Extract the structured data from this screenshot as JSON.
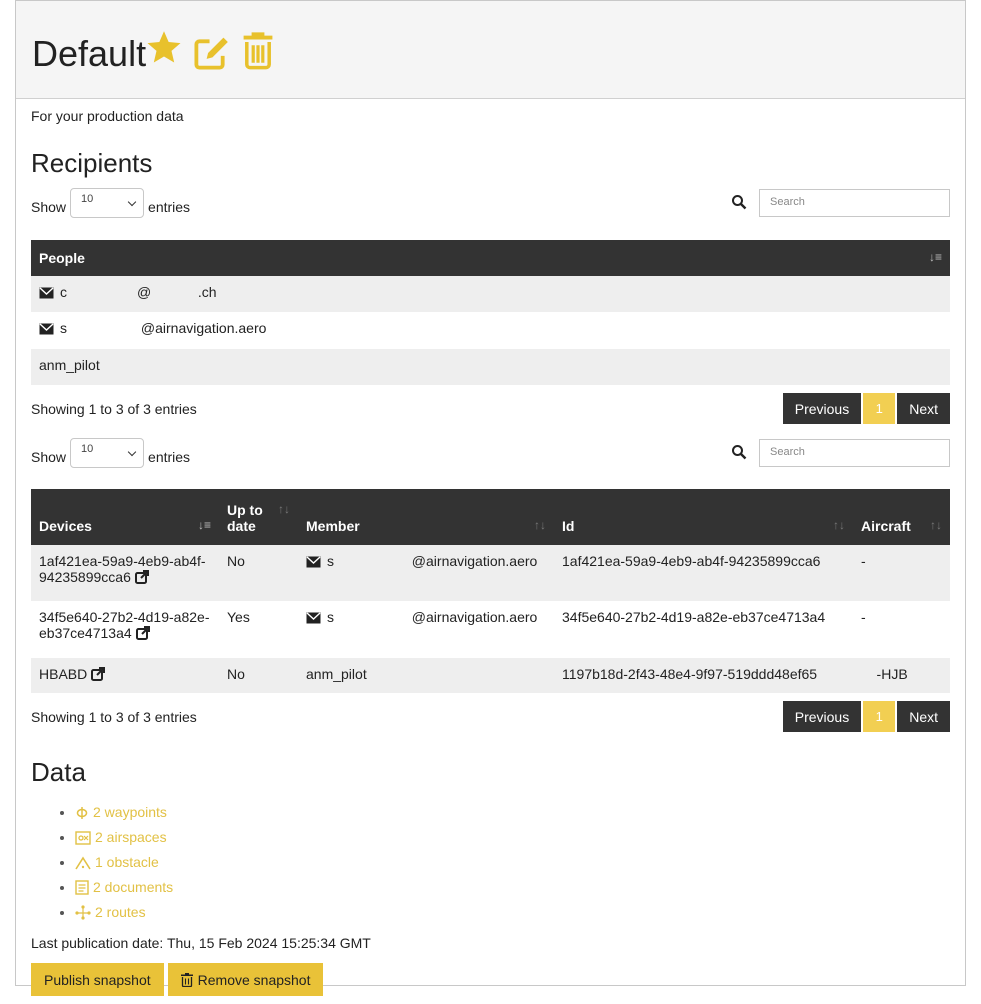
{
  "header": {
    "title": "Default",
    "icons": [
      "star-icon",
      "edit-icon",
      "trash-icon"
    ],
    "accent_color": "#e8c12c"
  },
  "description": "For your production data",
  "recipients": {
    "heading": "Recipients",
    "show_label": "Show",
    "entries_label": "entries",
    "length_value": "10",
    "search_placeholder": "Search",
    "columns": [
      "People"
    ],
    "rows": [
      {
        "icon": "mail-icon",
        "text": "c                  @            .ch"
      },
      {
        "icon": "mail-icon",
        "text": "s                   @airnavigation.aero"
      },
      {
        "icon": "",
        "text": "anm_pilot"
      }
    ],
    "info": "Showing 1 to 3 of 3 entries",
    "pager": {
      "previous": "Previous",
      "page": "1",
      "next": "Next"
    }
  },
  "devices": {
    "show_label": "Show",
    "entries_label": "entries",
    "length_value": "10",
    "search_placeholder": "Search",
    "columns": [
      "Devices",
      "Up to date",
      "Member",
      "Id",
      "Aircraft"
    ],
    "rows": [
      {
        "device": "1af421ea-59a9-4eb9-ab4f-94235899cca6",
        "uptodate": "No",
        "member_icon": "mail-icon",
        "member": "s                    @airnavigation.aero",
        "id": "1af421ea-59a9-4eb9-ab4f-94235899cca6",
        "aircraft": "-"
      },
      {
        "device": "34f5e640-27b2-4d19-a82e-eb37ce4713a4",
        "uptodate": "Yes",
        "member_icon": "mail-icon",
        "member": "s                    @airnavigation.aero",
        "id": "34f5e640-27b2-4d19-a82e-eb37ce4713a4",
        "aircraft": "-"
      },
      {
        "device": "HBABD",
        "uptodate": "No",
        "member_icon": "",
        "member": "anm_pilot",
        "id": "1197b18d-2f43-48e4-9f97-519ddd48ef65",
        "aircraft": "    -HJB"
      }
    ],
    "info": "Showing 1 to 3 of 3 entries",
    "pager": {
      "previous": "Previous",
      "page": "1",
      "next": "Next"
    }
  },
  "data_section": {
    "heading": "Data",
    "items": [
      {
        "icon": "waypoint-icon",
        "label": "2 waypoints"
      },
      {
        "icon": "airspace-icon",
        "label": "2 airspaces"
      },
      {
        "icon": "obstacle-icon",
        "label": "1 obstacle"
      },
      {
        "icon": "document-icon",
        "label": "2 documents"
      },
      {
        "icon": "route-icon",
        "label": "2 routes"
      }
    ],
    "last_publication": "Last publication date: Thu, 15 Feb 2024 15:25:34 GMT",
    "publish_label": "Publish snapshot",
    "remove_label": "Remove snapshot"
  }
}
